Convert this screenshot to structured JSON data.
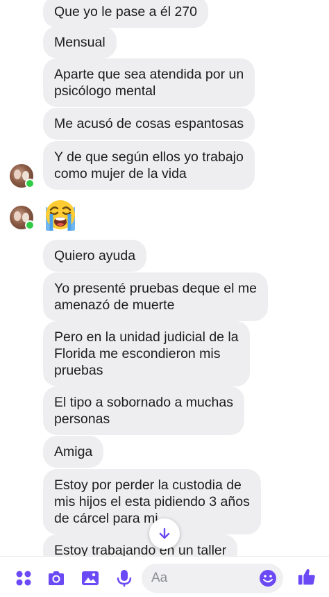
{
  "messages": [
    "Que yo le pase a él 270",
    "Mensual",
    "Aparte que sea atendida por un\npsicólogo mental",
    "Me acusó de cosas espantosas",
    "Y de que según ellos yo trabajo\ncomo mujer de la vida",
    "Quiero ayuda",
    "Yo presenté pruebas deque el me\namenazó de muerte",
    "Pero en la unidad judicial de la\nFlorida me escondieron mis\npruebas",
    "El tipo a sobornado a muchas\npersonas",
    "Amiga",
    "Estoy por perder la custodia de\nmis hijos el esta pidiendo 3 años\nde cárcel para mi",
    "Estoy trabajando en un taller"
  ],
  "emoji_message": "loudly-crying-face-emoji",
  "composer": {
    "placeholder": "Aa"
  },
  "icons": {
    "menu": "four-dots-icon",
    "camera": "camera-icon",
    "gallery": "image-icon",
    "voice": "microphone-icon",
    "emoji": "smiley-icon",
    "like": "thumbs-up-icon",
    "scroll": "arrow-down-icon"
  },
  "colors": {
    "accent": "#6b49f5",
    "bubble": "#eeeef0",
    "online": "#31cc46"
  }
}
